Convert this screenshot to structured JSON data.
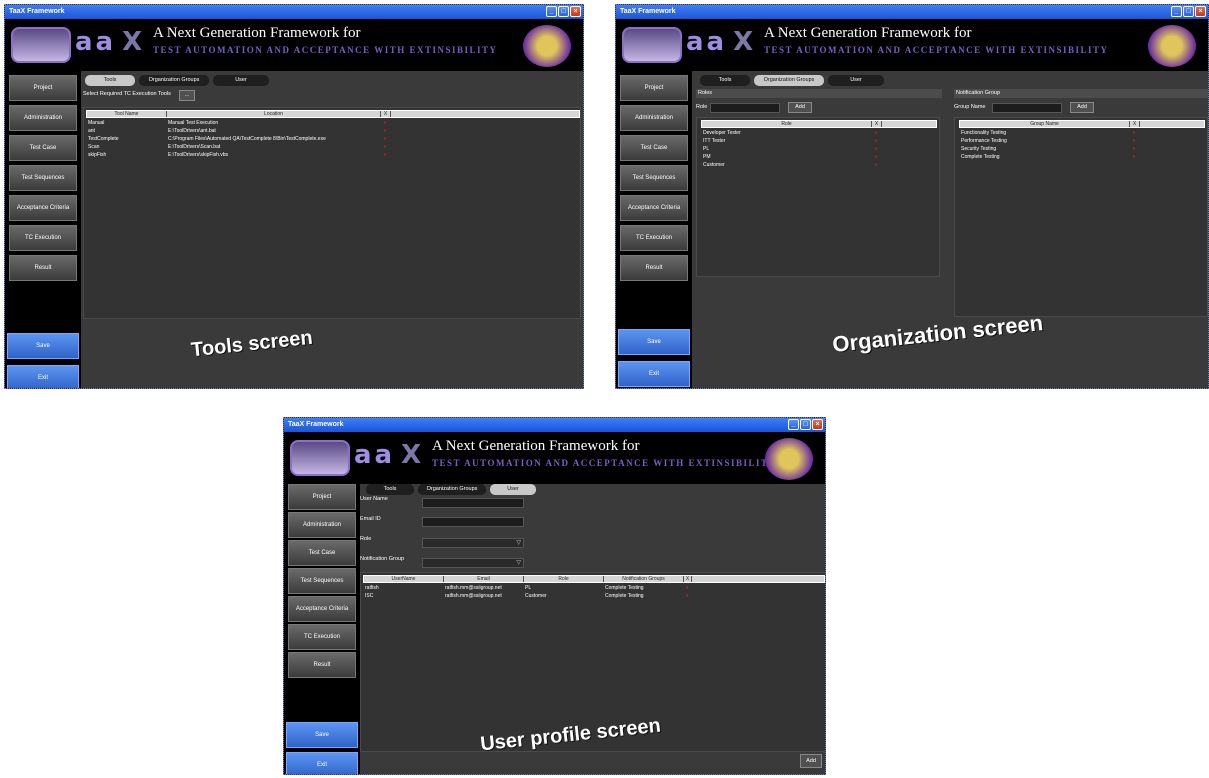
{
  "window_title": "TaaX Framework",
  "banner": {
    "letters": "aa",
    "x": "X",
    "headline": "A Next Generation Framework for",
    "subline": "TEST AUTOMATION AND ACCEPTANCE WITH EXTINSIBILITY"
  },
  "nav": [
    "Project",
    "Administration",
    "Test Case",
    "Test Sequences",
    "Acceptance Criteria",
    "TC Execution",
    "Result"
  ],
  "actions": {
    "save": "Save",
    "exit": "Exit"
  },
  "tabs": [
    "Tools",
    "Organization Groups",
    "User"
  ],
  "tools_screen": {
    "caption": "Tools screen",
    "select_label": "Select Required TC Execution Tools",
    "browse_label": "...",
    "columns": [
      "Tool Name",
      "Location",
      "X"
    ],
    "rows": [
      [
        "Manual",
        "Manual Test Execution"
      ],
      [
        "ant",
        "E:\\ToolDrivers\\ant.bat"
      ],
      [
        "TestComplete",
        "C:\\Program Files\\Automated QA\\TestComplete 8\\Bin\\TestComplete.exe"
      ],
      [
        "Scan",
        "E:\\ToolDrivers\\Scan.bat"
      ],
      [
        "skipFish",
        "E:\\ToolDrivers\\skipFish.vbs"
      ]
    ]
  },
  "org_screen": {
    "caption": "Organization  screen",
    "roles_title": "Roles",
    "role_label": "Role",
    "add_label": "Add",
    "role_columns": [
      "Role",
      "X"
    ],
    "roles": [
      "Developer Tester",
      "ITT Tester",
      "PL",
      "PM",
      "Customer"
    ],
    "group_title": "Notification Group",
    "group_label": "Group Name",
    "group_columns": [
      "Group Name",
      "X"
    ],
    "groups": [
      "Functionality Testing",
      "Performance Testing",
      "Security Testing",
      "Complete Testing"
    ]
  },
  "user_screen": {
    "caption": "User profile  screen",
    "user_name_label": "User Name",
    "email_label": "Email ID",
    "role_label": "Role",
    "group_label": "Notification Group",
    "columns": [
      "UserName",
      "Email",
      "Role",
      "Notification Groups",
      "X"
    ],
    "rows": [
      [
        "ratfish",
        "ratfish.mm@ssiigroup.net",
        "PL",
        "Complete Testing"
      ],
      [
        "ISC",
        "ratfish.mm@ssiigroup.net",
        "Customer",
        "Complete Testing"
      ]
    ],
    "add_label": "Add"
  },
  "delete_mark": "x",
  "dropdown_mark": "▽"
}
